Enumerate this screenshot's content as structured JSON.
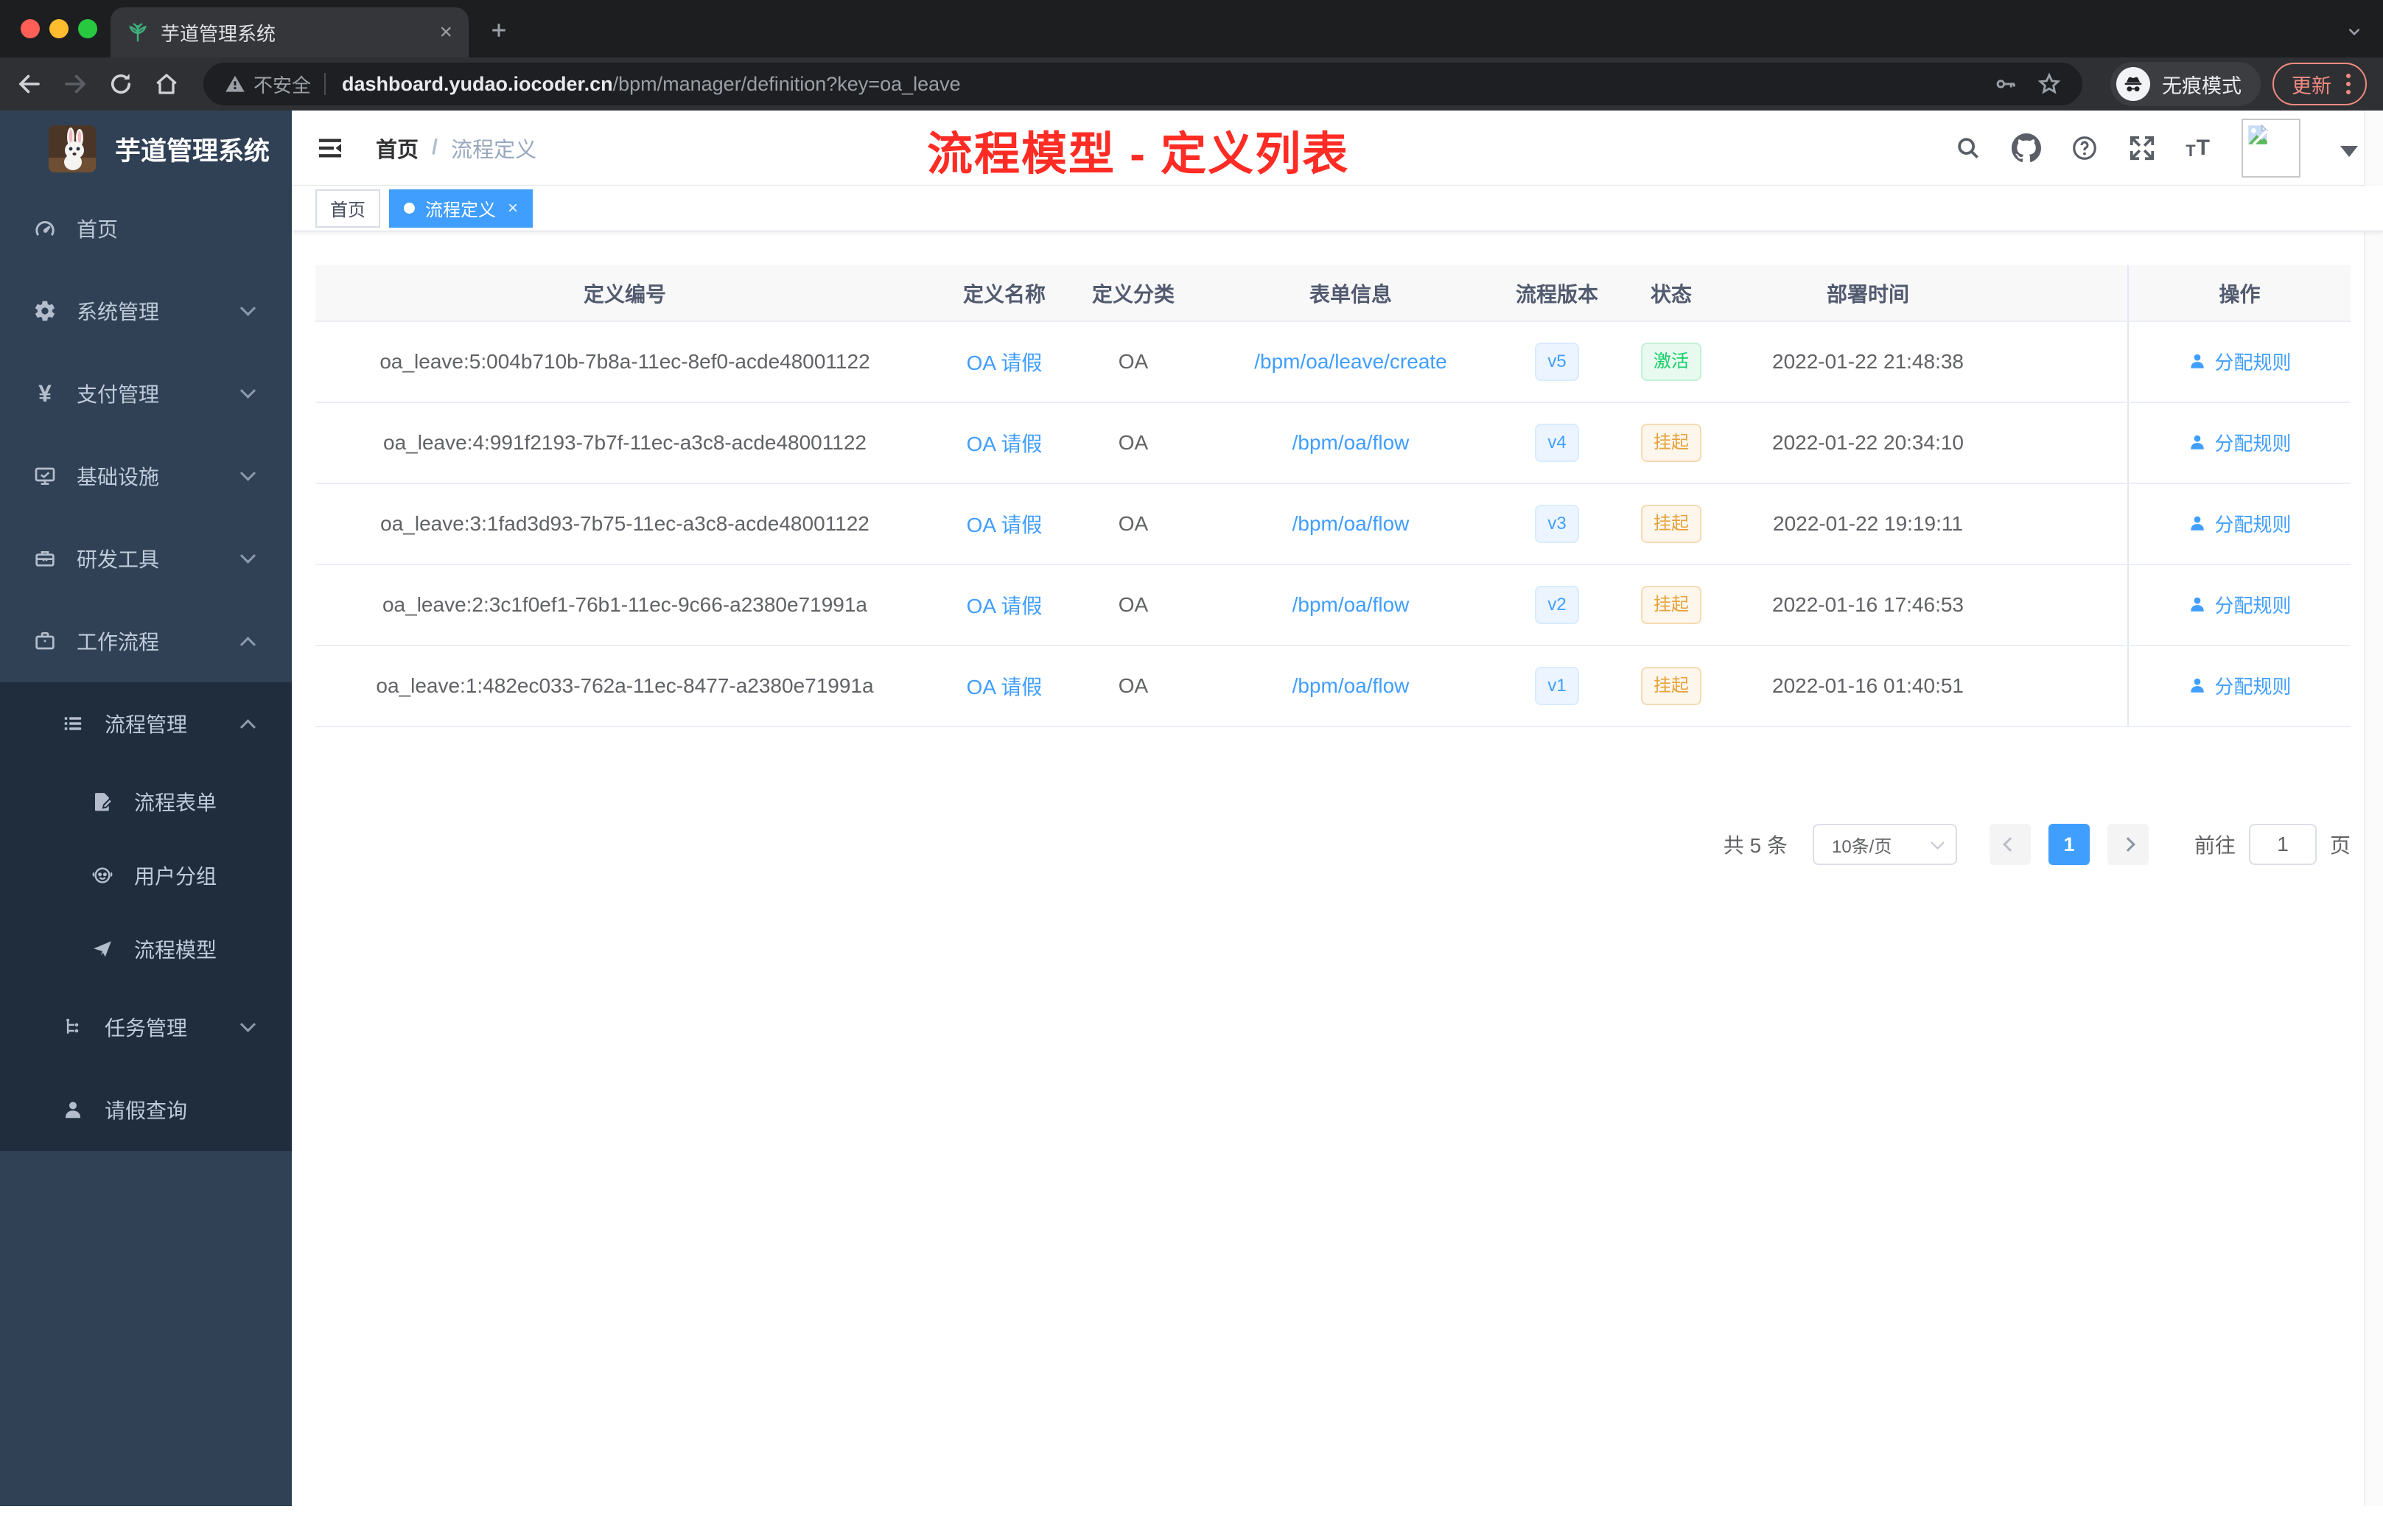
{
  "browser": {
    "tab_title": "芋道管理系统",
    "security_label": "不安全",
    "url_host": "dashboard.yudao.iocoder.cn",
    "url_path": "/bpm/manager/definition?key=oa_leave",
    "incognito_label": "无痕模式",
    "update_label": "更新"
  },
  "sidebar": {
    "app_title": "芋道管理系统",
    "menu": [
      {
        "label": "首页"
      },
      {
        "label": "系统管理"
      },
      {
        "label": "支付管理"
      },
      {
        "label": "基础设施"
      },
      {
        "label": "研发工具"
      },
      {
        "label": "工作流程"
      }
    ],
    "submenu": [
      {
        "label": "流程管理"
      },
      {
        "label": "流程表单"
      },
      {
        "label": "用户分组"
      },
      {
        "label": "流程模型"
      },
      {
        "label": "任务管理"
      },
      {
        "label": "请假查询"
      }
    ]
  },
  "navbar": {
    "breadcrumb": {
      "home": "首页",
      "separator": "/",
      "current": "流程定义"
    }
  },
  "annotation": "流程模型 - 定义列表",
  "tags_view": [
    {
      "label": "首页",
      "active": false
    },
    {
      "label": "流程定义",
      "active": true
    }
  ],
  "table": {
    "headers": [
      "定义编号",
      "定义名称",
      "定义分类",
      "表单信息",
      "流程版本",
      "状态",
      "部署时间",
      "操作"
    ],
    "action_label": "分配规则",
    "rows": [
      {
        "id": "oa_leave:5:004b710b-7b8a-11ec-8ef0-acde48001122",
        "name": "OA 请假",
        "category": "OA",
        "form": "/bpm/oa/leave/create",
        "version": "v5",
        "status": "激活",
        "status_type": "active",
        "deployed_at": "2022-01-22 21:48:38"
      },
      {
        "id": "oa_leave:4:991f2193-7b7f-11ec-a3c8-acde48001122",
        "name": "OA 请假",
        "category": "OA",
        "form": "/bpm/oa/flow",
        "version": "v4",
        "status": "挂起",
        "status_type": "suspended",
        "deployed_at": "2022-01-22 20:34:10"
      },
      {
        "id": "oa_leave:3:1fad3d93-7b75-11ec-a3c8-acde48001122",
        "name": "OA 请假",
        "category": "OA",
        "form": "/bpm/oa/flow",
        "version": "v3",
        "status": "挂起",
        "status_type": "suspended",
        "deployed_at": "2022-01-22 19:19:11"
      },
      {
        "id": "oa_leave:2:3c1f0ef1-76b1-11ec-9c66-a2380e71991a",
        "name": "OA 请假",
        "category": "OA",
        "form": "/bpm/oa/flow",
        "version": "v2",
        "status": "挂起",
        "status_type": "suspended",
        "deployed_at": "2022-01-16 17:46:53"
      },
      {
        "id": "oa_leave:1:482ec033-762a-11ec-8477-a2380e71991a",
        "name": "OA 请假",
        "category": "OA",
        "form": "/bpm/oa/flow",
        "version": "v1",
        "status": "挂起",
        "status_type": "suspended",
        "deployed_at": "2022-01-16 01:40:51"
      }
    ]
  },
  "pagination": {
    "total": "共 5 条",
    "page_size": "10条/页",
    "current_page": "1",
    "goto_label": "前往",
    "goto_value": "1",
    "unit_label": "页"
  },
  "colors": {
    "accent_blue": "#409eff",
    "success_green": "#13ce66",
    "warning_orange": "#e6a23c",
    "annotation_red": "#fe2c24",
    "sidebar_bg": "#304156",
    "submenu_bg": "#1f2d3d"
  }
}
